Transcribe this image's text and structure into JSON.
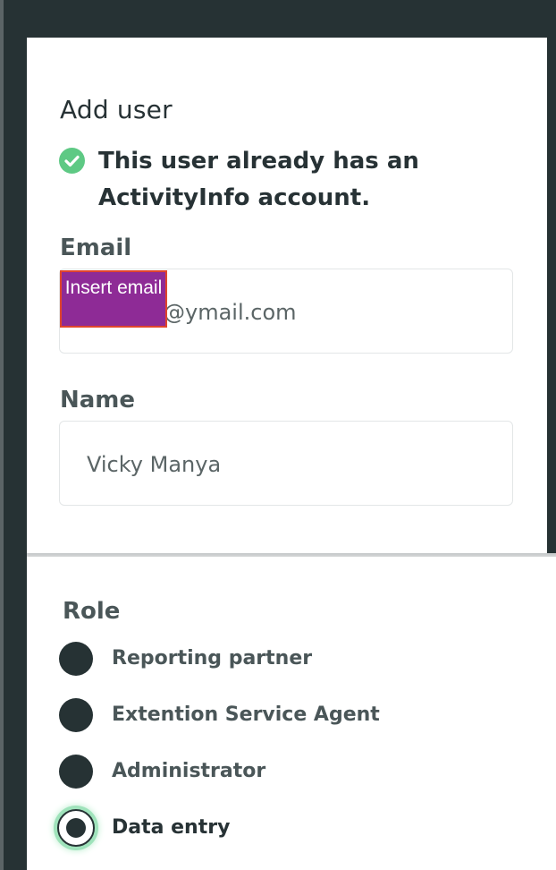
{
  "dialog": {
    "title": "Add user",
    "notice": "This user already has an ActivityInfo account."
  },
  "email": {
    "label": "Email",
    "value": "@ymail.com",
    "redaction_label": "Insert email"
  },
  "name": {
    "label": "Name",
    "value": "Vicky Manya"
  },
  "role": {
    "label": "Role",
    "options": [
      {
        "label": "Reporting partner",
        "selected": false
      },
      {
        "label": "Extention Service Agent",
        "selected": false
      },
      {
        "label": "Administrator",
        "selected": false
      },
      {
        "label": "Data entry",
        "selected": true
      }
    ]
  },
  "colors": {
    "backdrop": "#263234",
    "success": "#5ec984",
    "redaction": "#8e2b96",
    "redaction_border": "#e0452d"
  }
}
